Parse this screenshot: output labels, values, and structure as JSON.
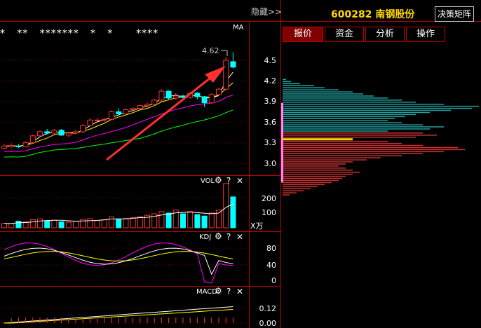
{
  "header": {
    "hide_label": "隐藏>>",
    "stock_code": "600282",
    "stock_name": "南钢股份",
    "decision_button": "决策矩阵"
  },
  "tabs": [
    {
      "label": "报价",
      "active": true
    },
    {
      "label": "资金",
      "active": false
    },
    {
      "label": "分析",
      "active": false
    },
    {
      "label": "操作",
      "active": false
    }
  ],
  "main_chart": {
    "indicator_label": "MA",
    "peak_label": "4.62",
    "star_rows": "*   **   *******   *   *      ****",
    "y_ticks": [
      "4.5",
      "4.2",
      "3.9",
      "3.6",
      "3.3",
      "3.0"
    ]
  },
  "volume_panel": {
    "label": "VOL",
    "y_ticks": [
      "200",
      "100"
    ],
    "unit": "X万",
    "gear_icon": "gear-icon",
    "help_icon": "?",
    "close_icon": "✕"
  },
  "kdj_panel": {
    "label": "KDJ",
    "y_ticks": [
      "80",
      "40",
      "0"
    ],
    "help_icon": "?",
    "close_icon": "✕"
  },
  "macd_panel": {
    "label": "MACD",
    "y_ticks": [
      "0.12",
      "0.00"
    ],
    "help_icon": "?",
    "close_icon": "✕"
  },
  "colors": {
    "up": "#ff3232",
    "down": "#00ffff",
    "grid": "#800000",
    "ma_white": "#ffffff",
    "ma_yellow": "#ffff00",
    "ma_magenta": "#ff00ff",
    "ma_green": "#00ff00",
    "arrow": "#ff3030",
    "chip_cyan": "#20a0a0",
    "chip_red": "#c83232",
    "chip_marker": "#ffd700"
  },
  "chart_data": {
    "type": "candlestick",
    "candles": [
      {
        "o": 3.22,
        "c": 3.25,
        "h": 3.28,
        "l": 3.2
      },
      {
        "o": 3.24,
        "c": 3.26,
        "h": 3.29,
        "l": 3.22
      },
      {
        "o": 3.25,
        "c": 3.24,
        "h": 3.28,
        "l": 3.22
      },
      {
        "o": 3.24,
        "c": 3.3,
        "h": 3.32,
        "l": 3.23
      },
      {
        "o": 3.3,
        "c": 3.4,
        "h": 3.42,
        "l": 3.29
      },
      {
        "o": 3.4,
        "c": 3.46,
        "h": 3.48,
        "l": 3.38
      },
      {
        "o": 3.46,
        "c": 3.44,
        "h": 3.5,
        "l": 3.42
      },
      {
        "o": 3.44,
        "c": 3.48,
        "h": 3.5,
        "l": 3.42
      },
      {
        "o": 3.48,
        "c": 3.41,
        "h": 3.5,
        "l": 3.4
      },
      {
        "o": 3.41,
        "c": 3.44,
        "h": 3.46,
        "l": 3.38
      },
      {
        "o": 3.44,
        "c": 3.46,
        "h": 3.49,
        "l": 3.42
      },
      {
        "o": 3.46,
        "c": 3.55,
        "h": 3.57,
        "l": 3.44
      },
      {
        "o": 3.55,
        "c": 3.63,
        "h": 3.66,
        "l": 3.54
      },
      {
        "o": 3.63,
        "c": 3.63,
        "h": 3.66,
        "l": 3.6
      },
      {
        "o": 3.63,
        "c": 3.64,
        "h": 3.66,
        "l": 3.6
      },
      {
        "o": 3.64,
        "c": 3.75,
        "h": 3.77,
        "l": 3.63
      },
      {
        "o": 3.75,
        "c": 3.72,
        "h": 3.8,
        "l": 3.7
      },
      {
        "o": 3.72,
        "c": 3.78,
        "h": 3.8,
        "l": 3.7
      },
      {
        "o": 3.78,
        "c": 3.8,
        "h": 3.82,
        "l": 3.76
      },
      {
        "o": 3.8,
        "c": 3.84,
        "h": 3.86,
        "l": 3.78
      },
      {
        "o": 3.84,
        "c": 3.86,
        "h": 3.88,
        "l": 3.82
      },
      {
        "o": 3.86,
        "c": 3.92,
        "h": 3.94,
        "l": 3.84
      },
      {
        "o": 3.92,
        "c": 4.05,
        "h": 4.08,
        "l": 3.9
      },
      {
        "o": 4.05,
        "c": 3.95,
        "h": 4.06,
        "l": 3.92
      },
      {
        "o": 3.95,
        "c": 3.98,
        "h": 4.02,
        "l": 3.92
      },
      {
        "o": 3.98,
        "c": 3.96,
        "h": 4.0,
        "l": 3.94
      },
      {
        "o": 3.96,
        "c": 4.02,
        "h": 4.04,
        "l": 3.94
      },
      {
        "o": 4.02,
        "c": 3.97,
        "h": 4.04,
        "l": 3.93
      },
      {
        "o": 3.97,
        "c": 3.88,
        "h": 3.98,
        "l": 3.82
      },
      {
        "o": 3.88,
        "c": 4.0,
        "h": 4.02,
        "l": 3.86
      },
      {
        "o": 4.0,
        "c": 4.08,
        "h": 4.1,
        "l": 3.98
      },
      {
        "o": 4.08,
        "c": 4.5,
        "h": 4.55,
        "l": 4.06
      },
      {
        "o": 4.48,
        "c": 4.4,
        "h": 4.62,
        "l": 4.38
      }
    ],
    "volume": [
      30,
      28,
      45,
      40,
      55,
      60,
      48,
      52,
      40,
      38,
      44,
      58,
      62,
      50,
      55,
      75,
      60,
      64,
      70,
      75,
      85,
      95,
      110,
      100,
      120,
      95,
      110,
      90,
      80,
      100,
      120,
      300,
      210
    ],
    "chips": [
      {
        "p": 4.22,
        "w": 5,
        "c": "cyan"
      },
      {
        "p": 4.19,
        "w": 12,
        "c": "cyan"
      },
      {
        "p": 4.16,
        "w": 25,
        "c": "cyan"
      },
      {
        "p": 4.13,
        "w": 45,
        "c": "cyan"
      },
      {
        "p": 4.1,
        "w": 60,
        "c": "cyan"
      },
      {
        "p": 4.07,
        "w": 80,
        "c": "cyan"
      },
      {
        "p": 4.04,
        "w": 100,
        "c": "cyan"
      },
      {
        "p": 4.01,
        "w": 115,
        "c": "cyan"
      },
      {
        "p": 3.98,
        "w": 130,
        "c": "cyan"
      },
      {
        "p": 3.95,
        "w": 150,
        "c": "cyan"
      },
      {
        "p": 3.92,
        "w": 170,
        "c": "cyan"
      },
      {
        "p": 3.89,
        "w": 190,
        "c": "cyan"
      },
      {
        "p": 3.86,
        "w": 230,
        "c": "cyan"
      },
      {
        "p": 3.83,
        "w": 280,
        "c": "cyan"
      },
      {
        "p": 3.8,
        "w": 270,
        "c": "cyan"
      },
      {
        "p": 3.77,
        "w": 240,
        "c": "cyan"
      },
      {
        "p": 3.74,
        "w": 210,
        "c": "cyan"
      },
      {
        "p": 3.71,
        "w": 190,
        "c": "cyan"
      },
      {
        "p": 3.68,
        "w": 175,
        "c": "cyan"
      },
      {
        "p": 3.65,
        "w": 160,
        "c": "cyan"
      },
      {
        "p": 3.62,
        "w": 150,
        "c": "cyan"
      },
      {
        "p": 3.59,
        "w": 170,
        "c": "cyan"
      },
      {
        "p": 3.56,
        "w": 200,
        "c": "cyan"
      },
      {
        "p": 3.53,
        "w": 230,
        "c": "cyan"
      },
      {
        "p": 3.5,
        "w": 210,
        "c": "cyan"
      },
      {
        "p": 3.47,
        "w": 150,
        "c": "cyan"
      },
      {
        "p": 3.44,
        "w": 200,
        "c": "red"
      },
      {
        "p": 3.41,
        "w": 220,
        "c": "red"
      },
      {
        "p": 3.38,
        "w": 190,
        "c": "red"
      },
      {
        "p": 3.35,
        "w": 100,
        "c": "marker"
      },
      {
        "p": 3.32,
        "w": 150,
        "c": "red"
      },
      {
        "p": 3.29,
        "w": 170,
        "c": "red"
      },
      {
        "p": 3.26,
        "w": 200,
        "c": "red"
      },
      {
        "p": 3.23,
        "w": 250,
        "c": "red"
      },
      {
        "p": 3.2,
        "w": 260,
        "c": "red"
      },
      {
        "p": 3.17,
        "w": 230,
        "c": "red"
      },
      {
        "p": 3.14,
        "w": 200,
        "c": "red"
      },
      {
        "p": 3.11,
        "w": 170,
        "c": "red"
      },
      {
        "p": 3.08,
        "w": 140,
        "c": "red"
      },
      {
        "p": 3.05,
        "w": 120,
        "c": "red"
      },
      {
        "p": 3.02,
        "w": 100,
        "c": "red"
      },
      {
        "p": 2.99,
        "w": 90,
        "c": "red"
      },
      {
        "p": 2.96,
        "w": 80,
        "c": "red"
      },
      {
        "p": 2.93,
        "w": 90,
        "c": "red"
      },
      {
        "p": 2.9,
        "w": 100,
        "c": "red"
      },
      {
        "p": 2.87,
        "w": 110,
        "c": "red"
      },
      {
        "p": 2.84,
        "w": 100,
        "c": "red"
      },
      {
        "p": 2.81,
        "w": 90,
        "c": "red"
      },
      {
        "p": 2.78,
        "w": 85,
        "c": "red"
      },
      {
        "p": 2.75,
        "w": 80,
        "c": "red"
      },
      {
        "p": 2.72,
        "w": 70,
        "c": "red"
      },
      {
        "p": 2.69,
        "w": 60,
        "c": "red"
      },
      {
        "p": 2.66,
        "w": 50,
        "c": "red"
      },
      {
        "p": 2.63,
        "w": 40,
        "c": "red"
      },
      {
        "p": 2.6,
        "w": 30,
        "c": "red"
      },
      {
        "p": 2.57,
        "w": 20,
        "c": "red"
      },
      {
        "p": 2.54,
        "w": 10,
        "c": "red"
      }
    ],
    "ylim": [
      2.85,
      4.72
    ]
  }
}
